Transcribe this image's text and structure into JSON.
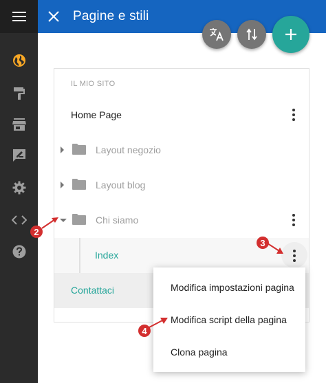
{
  "header": {
    "title": "Pagine e stili",
    "close_icon": "close-icon",
    "bar_color": "#1565c0"
  },
  "fabs": [
    {
      "name": "translate-button",
      "icon": "translate-icon"
    },
    {
      "name": "sort-button",
      "icon": "swap-vert-icon"
    },
    {
      "name": "add-button",
      "icon": "plus-icon",
      "color": "#26a69a"
    }
  ],
  "sidebar": {
    "menu_icon": "hamburger-icon",
    "icons": [
      "globe-icon",
      "paint-roller-icon",
      "store-icon",
      "rate-review-icon",
      "gear-icon",
      "code-icon",
      "help-icon"
    ],
    "active_icon_color": "#f9a825"
  },
  "panel": {
    "section_label": "IL MIO SITO",
    "items": [
      {
        "label": "Home Page"
      },
      {
        "label": "Layout negozio"
      },
      {
        "label": "Layout blog"
      },
      {
        "label": "Chi siamo"
      },
      {
        "label": "Index"
      },
      {
        "label": "Contattaci"
      }
    ]
  },
  "context_menu": {
    "items": [
      "Modifica impostazioni pagina",
      "Modifica script della pagina",
      "Clona pagina"
    ]
  },
  "annotations": [
    "2",
    "3",
    "4"
  ],
  "colors": {
    "teal": "#26a69a",
    "grey_text": "#9e9e9e",
    "annotation_red": "#d32f2f"
  }
}
